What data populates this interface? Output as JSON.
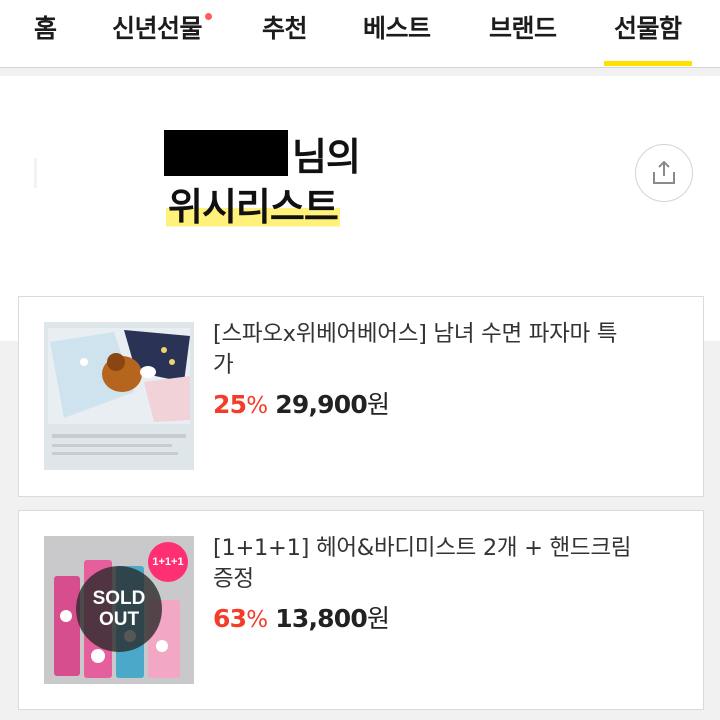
{
  "nav": {
    "tabs": [
      {
        "label": "홈"
      },
      {
        "label": "신년선물",
        "has_dot": true
      },
      {
        "label": "추천"
      },
      {
        "label": "베스트"
      },
      {
        "label": "브랜드"
      },
      {
        "label": "선물함",
        "active": true
      }
    ],
    "accent_color": "#ffe000",
    "dot_color": "#ff5a5f"
  },
  "header": {
    "name_suffix": "님의",
    "title": "위시리스트",
    "highlight_color": "#fff17a",
    "share_icon": "share-icon"
  },
  "wishlist": {
    "items": [
      {
        "title": "[스파오x위베어베어스] 남녀 수면 파자마 특가",
        "discount": "25",
        "discount_unit": "%",
        "price": "29,900",
        "currency": "원"
      },
      {
        "title": "[1+1+1] 헤어&바디미스트 2개 + 핸드크림 증정",
        "discount": "63",
        "discount_unit": "%",
        "price": "13,800",
        "currency": "원",
        "sold_out_line1": "SOLD",
        "sold_out_line2": "OUT",
        "badge": "1+1+1"
      }
    ],
    "discount_color": "#f43c2b"
  }
}
